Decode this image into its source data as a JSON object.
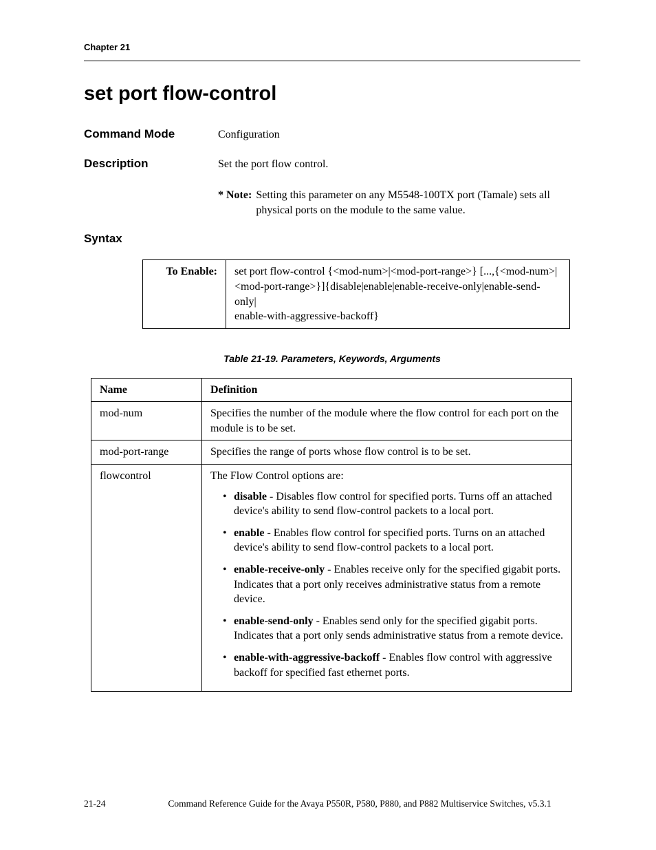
{
  "header": {
    "chapter": "Chapter 21"
  },
  "title": "set port flow-control",
  "fields": {
    "command_mode_label": "Command Mode",
    "command_mode_value": "Configuration",
    "description_label": "Description",
    "description_value": "Set the port flow control.",
    "note_label": "* Note:",
    "note_text": "Setting this parameter on any M5548-100TX port (Tamale) sets all physical ports on the module to the same value."
  },
  "syntax": {
    "heading": "Syntax",
    "row_label": "To Enable:",
    "row_text": "set port flow-control {<mod-num>|<mod-port-range>} [...,{<mod-num>|<mod-port-range>}]{disable|enable|enable-receive-only|enable-send-only|\nenable-with-aggressive-backoff}"
  },
  "table": {
    "caption": "Table 21-19.  Parameters, Keywords, Arguments",
    "head_name": "Name",
    "head_def": "Definition",
    "r1_name": "mod-num",
    "r1_def": "Specifies the number of the module where the flow control for each port on the module is to be set.",
    "r2_name": "mod-port-range",
    "r2_def": "Specifies the range of ports whose flow control is to be set.",
    "r3_name": "flowcontrol",
    "r3_intro": "The Flow Control options are:",
    "opts": {
      "o1_name": "disable",
      "o1_text": " - Disables flow control for specified ports. Turns off an attached device's ability to send flow-control packets to a local port.",
      "o2_name": "enable",
      "o2_text": " - Enables flow control for specified ports. Turns on an attached device's ability to send flow-control packets to a local port.",
      "o3_name": "enable-receive-only",
      "o3_text": " - Enables receive only for the specified gigabit ports. Indicates that a port only receives administrative status from a remote device.",
      "o4_name": "enable-send-only",
      "o4_text": " - Enables send only for the specified gigabit ports. Indicates that a port only sends administrative status from a remote device.",
      "o5_name": " enable-with-aggressive-backoff",
      "o5_text": " - Enables flow control with aggressive backoff for specified fast ethernet ports."
    }
  },
  "footer": {
    "page": "21-24",
    "text": "Command Reference Guide for the Avaya P550R, P580, P880, and P882 Multiservice Switches, v5.3.1"
  }
}
